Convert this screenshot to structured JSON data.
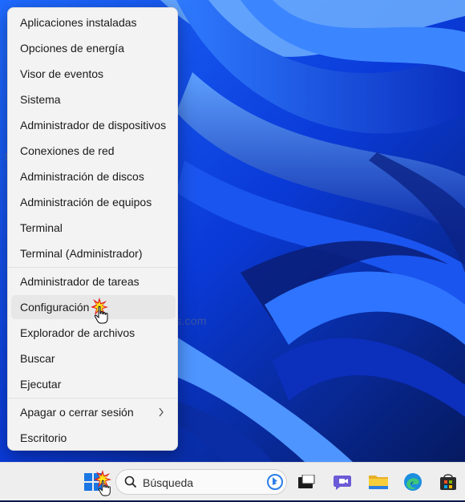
{
  "menu": {
    "items": [
      {
        "label": "Aplicaciones instaladas"
      },
      {
        "label": "Opciones de energía"
      },
      {
        "label": "Visor de eventos"
      },
      {
        "label": "Sistema"
      },
      {
        "label": "Administrador de dispositivos"
      },
      {
        "label": "Conexiones de red"
      },
      {
        "label": "Administración de discos"
      },
      {
        "label": "Administración de equipos"
      },
      {
        "label": "Terminal"
      },
      {
        "label": "Terminal (Administrador)"
      },
      {
        "label": "Administrador de tareas"
      },
      {
        "label": "Configuración",
        "hovered": true
      },
      {
        "label": "Explorador de archivos"
      },
      {
        "label": "Buscar"
      },
      {
        "label": "Ejecutar"
      },
      {
        "label": "Apagar o cerrar sesión",
        "has_submenu": true
      },
      {
        "label": "Escritorio"
      }
    ]
  },
  "watermark": "trucoswindows.com",
  "taskbar": {
    "search_placeholder": "Búsqueda",
    "icons": [
      "windows-start-icon",
      "search-icon",
      "bing-icon",
      "task-view-icon",
      "teams-chat-icon",
      "file-explorer-icon",
      "edge-icon",
      "store-icon"
    ]
  },
  "colors": {
    "menu_bg": "#f3f3f3",
    "hover_bg": "#e7e7e7",
    "wallpaper_blue": "#1f5bff",
    "taskbar_bg": "#eeeeee"
  }
}
